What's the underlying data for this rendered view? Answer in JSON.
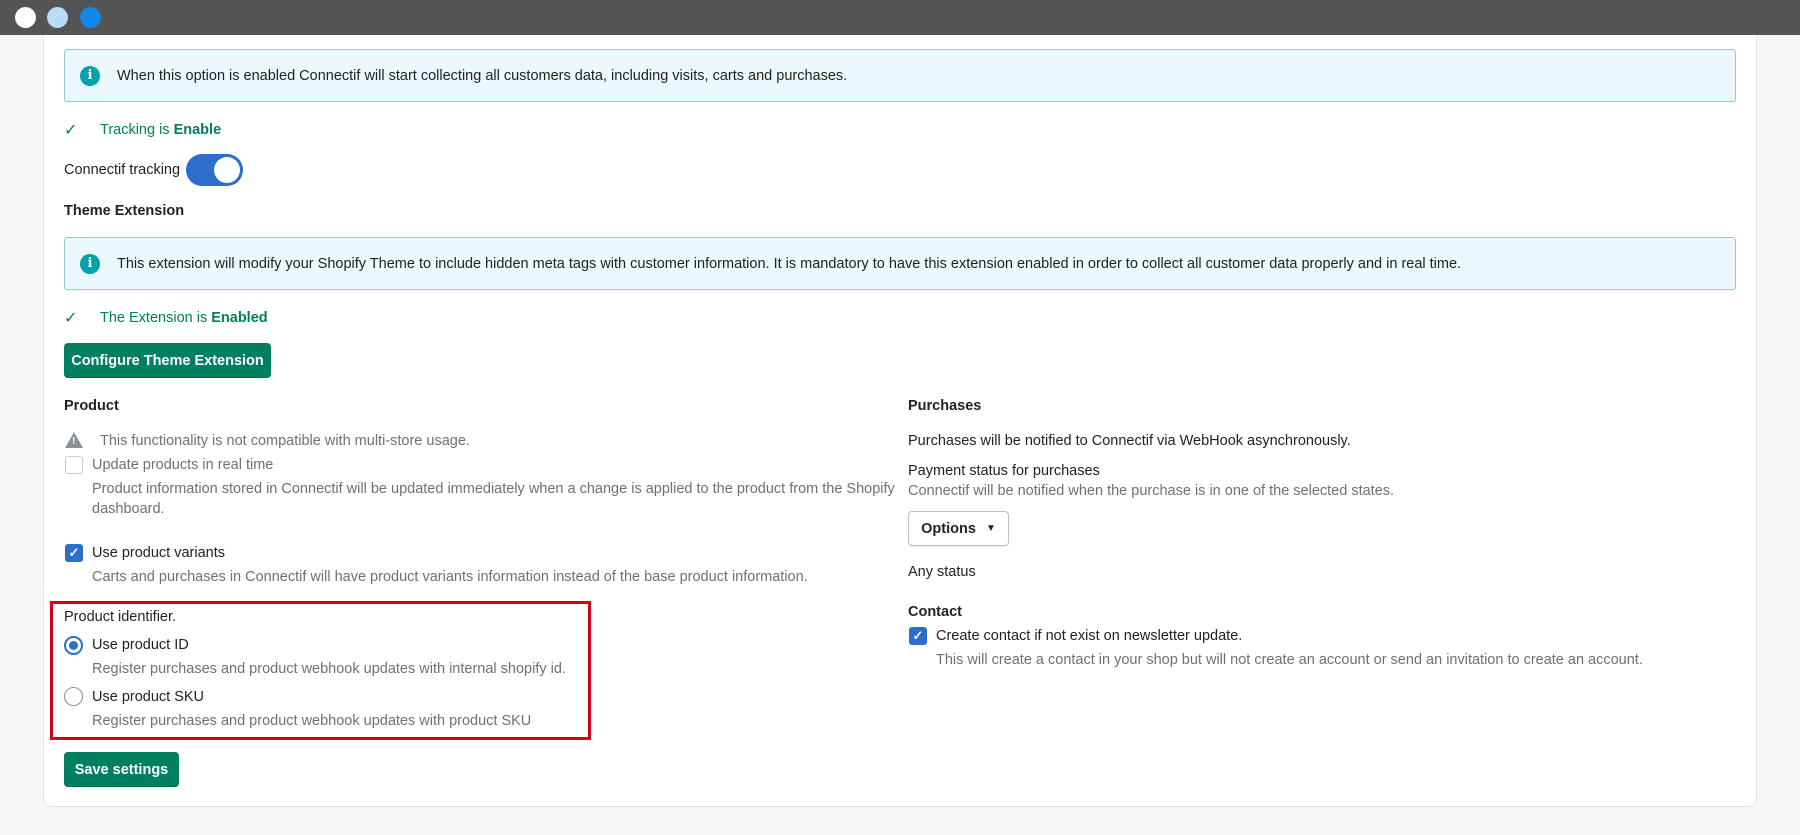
{
  "window": {
    "dots": [
      "close",
      "minimize",
      "maximize"
    ]
  },
  "tracking": {
    "banner_text": "When this option is enabled Connectif will start collecting all customers data, including visits, carts and purchases.",
    "status_prefix": "Tracking is ",
    "status_value": "Enable",
    "toggle_label": "Connectif tracking",
    "toggle_on": true
  },
  "theme_extension": {
    "heading": "Theme Extension",
    "banner_text": "This extension will modify your Shopify Theme to include hidden meta tags with customer information. It is mandatory to have this extension enabled in order to collect all customer data properly and in real time.",
    "status_prefix": "The Extension is ",
    "status_value": "Enabled",
    "configure_button": "Configure Theme Extension"
  },
  "product": {
    "heading": "Product",
    "warning": "This functionality is not compatible with multi-store usage.",
    "realtime_label": "Update products in real time",
    "realtime_desc_1": "Product information stored in Connectif will be updated immediately when a change is applied to the product from the Shopify",
    "realtime_desc_2": "dashboard.",
    "variants_label": "Use product variants",
    "variants_desc": "Carts and purchases in Connectif will have product variants information instead of the base product information.",
    "identifier_label": "Product identifier.",
    "use_id_label": "Use product ID",
    "use_id_desc": "Register purchases and product webhook updates with internal shopify id.",
    "use_sku_label": "Use product SKU",
    "use_sku_desc": "Register purchases and product webhook updates with product SKU"
  },
  "purchases": {
    "heading": "Purchases",
    "note": "Purchases will be notified to Connectif via WebHook asynchronously.",
    "payment_label": "Payment status for purchases",
    "payment_desc": "Connectif will be notified when the purchase is in one of the selected states.",
    "options_button": "Options",
    "selected_status": "Any status"
  },
  "contact": {
    "heading": "Contact",
    "create_label": "Create contact if not exist on newsletter update.",
    "create_desc": "This will create a contact in your shop but will not create an account or send an invitation to create an account."
  },
  "save_button": "Save settings",
  "colors": {
    "accent_blue": "#2c6ecb",
    "primary_green": "#008060",
    "highlight_red": "#d0021b",
    "info_teal": "#00a0ac"
  }
}
